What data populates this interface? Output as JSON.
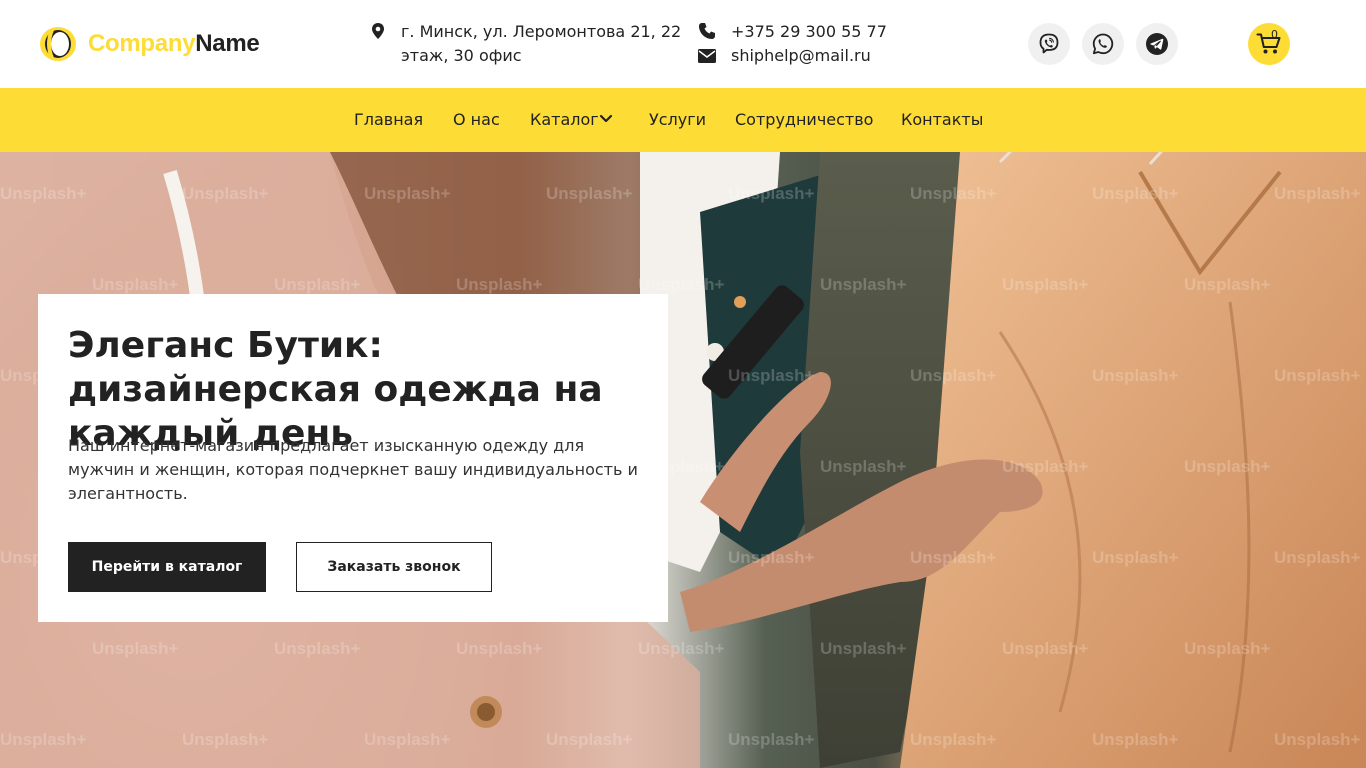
{
  "brand": {
    "logo_part1": "Company",
    "logo_part2": "Name",
    "accent_color": "#fddc35",
    "dark_color": "#222222"
  },
  "contact": {
    "address_line1": "г. Минск, ул. Леромонтова 21, 22",
    "address_line2": "этаж, 30 офис",
    "phone": "+375 29 300 55 77",
    "email": "shiphelp@mail.ru"
  },
  "social": [
    {
      "name": "viber-icon"
    },
    {
      "name": "whatsapp-icon"
    },
    {
      "name": "telegram-icon"
    }
  ],
  "cart": {
    "count": "0",
    "icon": "cart-icon"
  },
  "nav": {
    "items": [
      {
        "label": "Главная"
      },
      {
        "label": "О нас"
      },
      {
        "label": "Каталог"
      },
      {
        "label": "Услуги"
      },
      {
        "label": "Сотрудничество"
      },
      {
        "label": "Контакты"
      }
    ]
  },
  "hero": {
    "title_bold": "Элеганс Бутик:",
    "title_rest": " дизайнерская одежда на каждый день",
    "description": "Наш интернет-магазин предлагает изысканную одежду для мужчин и женщин, которая подчеркнет вашу индивидуальность и элегантность.",
    "primary_button": "Перейти в каталог",
    "secondary_button": "Заказать звонок",
    "watermark": "Unsplash+"
  }
}
